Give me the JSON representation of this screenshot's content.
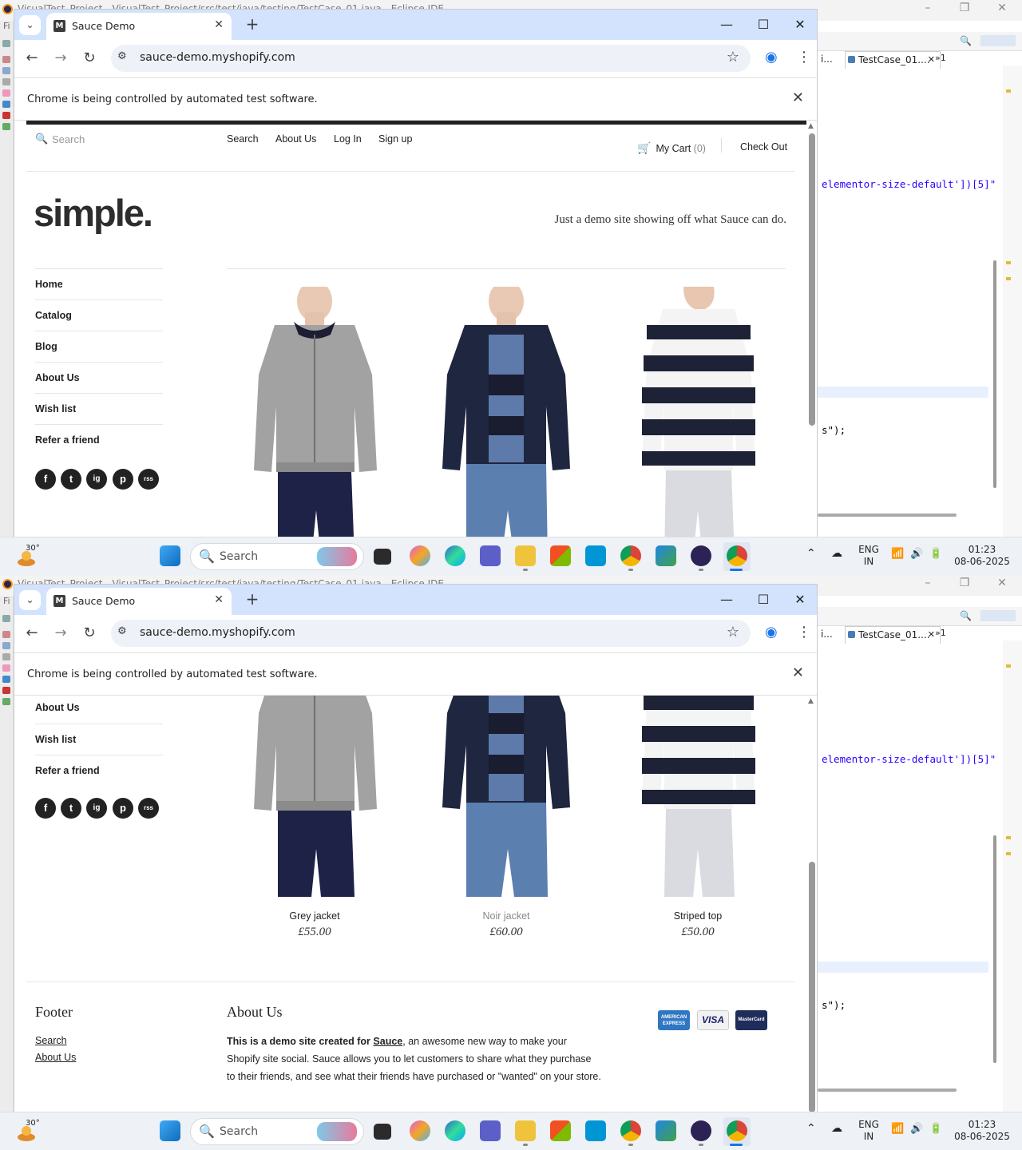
{
  "ide": {
    "title": "VisualTest_Project - VisualTest_Project/src/test/java/testing/TestCase_01.java - Eclipse IDE",
    "menu_initial": "Fi",
    "tab_label": "TestCase_01....",
    "tab_prev": "i...",
    "tab_overflow": "»1",
    "code_line_1": "elementor-size-default'])[5]\"",
    "code_line_2": "s\");"
  },
  "browser": {
    "tab_title": "Sauce Demo",
    "favicon_letter": "M",
    "url": "sauce-demo.myshopify.com",
    "infobar_text": "Chrome is being controlled by automated test software."
  },
  "shop": {
    "search_placeholder": "Search",
    "nav": [
      "Search",
      "About Us",
      "Log In",
      "Sign up"
    ],
    "cart_label": "My Cart",
    "cart_count": "(0)",
    "checkout": "Check Out",
    "logo": "simple.",
    "tagline": "Just a demo site showing off what Sauce can do.",
    "sidebar": [
      "Home",
      "Catalog",
      "Blog",
      "About Us",
      "Wish list",
      "Refer a friend"
    ],
    "social": [
      "f",
      "t",
      "ig",
      "p",
      "rss"
    ],
    "products": [
      {
        "name": "Grey jacket",
        "price": "£55.00"
      },
      {
        "name": "Noir jacket",
        "price": "£60.00"
      },
      {
        "name": "Striped top",
        "price": "£50.00"
      }
    ],
    "footer": {
      "heading": "Footer",
      "links": [
        "Search",
        "About Us"
      ],
      "about_heading": "About Us",
      "about_bold": "This is a demo site created for ",
      "about_link": "Sauce",
      "about_rest": ", an awesome new way to make your Shopify site social. Sauce allows you to let customers to share what they purchase to their friends, and see what their friends have purchased or \"wanted\" on your store.",
      "payments": [
        "AMERICAN EXPRESS",
        "VISA",
        "MasterCard"
      ]
    }
  },
  "taskbar": {
    "temp": "30°",
    "search": "Search",
    "lang_1": "ENG",
    "lang_2": "IN",
    "time": "01:23",
    "date": "08-06-2025"
  },
  "colors": {
    "tabstrip": "#d3e3fd",
    "accent": "#1a73e8",
    "text": "#222222"
  }
}
